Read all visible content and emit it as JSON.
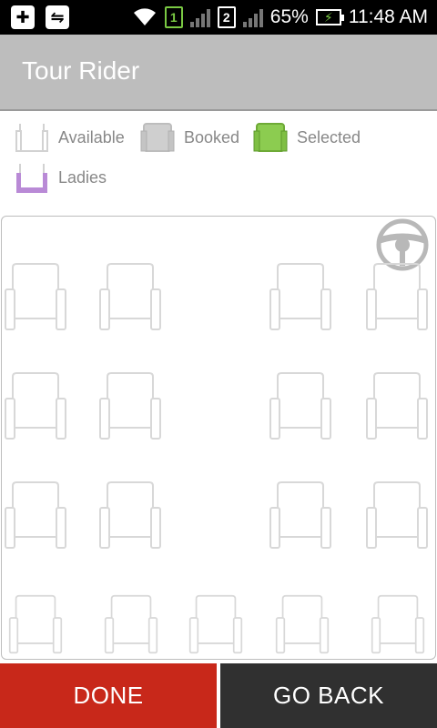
{
  "status_bar": {
    "sim1": "1",
    "sim2": "2",
    "battery_percent": "65%",
    "time": "11:48 AM",
    "icons": [
      "plus-icon",
      "usb-icon",
      "wifi-icon",
      "signal-icon",
      "battery-charging-icon"
    ]
  },
  "app_bar": {
    "title": "Tour Rider"
  },
  "legend": {
    "available": "Available",
    "booked": "Booked",
    "selected": "Selected",
    "ladies": "Ladies"
  },
  "colors": {
    "available": "#d9d9d9",
    "booked": "#c8c8c8",
    "selected": "#8ccc50",
    "ladies": "#b98ad6",
    "done": "#c8281a",
    "back": "#303030"
  },
  "seat_layout": {
    "rows": [
      [
        "available",
        "available",
        "aisle",
        "available",
        "available"
      ],
      [
        "available",
        "available",
        "aisle",
        "available",
        "available"
      ],
      [
        "available",
        "available",
        "aisle",
        "available",
        "available"
      ],
      [
        "available",
        "available",
        "available",
        "available",
        "available"
      ]
    ]
  },
  "buttons": {
    "done": "DONE",
    "go_back": "GO BACK"
  }
}
